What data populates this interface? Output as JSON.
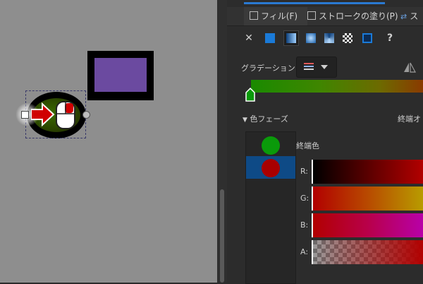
{
  "tabs": [
    {
      "label": "フィル(F)"
    },
    {
      "label": "ストロークの塗り(P)"
    },
    {
      "label": "ス"
    }
  ],
  "gradient": {
    "label": "グラデーション:",
    "color_start": "#1a8a00",
    "color_end": "#8a3a00"
  },
  "phases": {
    "header": "色フェーズ",
    "right_label": "終端オ",
    "stops": [
      {
        "color": "#0a9a0a"
      },
      {
        "color": "#a80000",
        "selected": true
      }
    ],
    "end_color_label": "終端色"
  },
  "channels": [
    {
      "label": "R:"
    },
    {
      "label": "G:"
    },
    {
      "label": "B:"
    },
    {
      "label": "A:"
    }
  ],
  "colors": {
    "accent": "#2a79d2",
    "selection": "#0e4a86",
    "canvas_bg": "#8e8e8e",
    "shape_purple": "#6b4aa0"
  },
  "icons": [
    "close-icon",
    "help-icon",
    "gradient-preset-icon",
    "reverse-gradient-icon",
    "mouse-icon",
    "arrow-icon"
  ]
}
